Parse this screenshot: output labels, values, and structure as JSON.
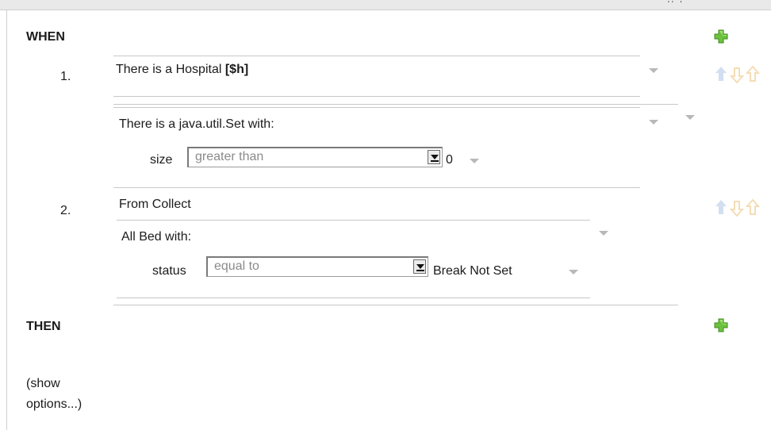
{
  "when": {
    "label": "WHEN"
  },
  "then": {
    "label": "THEN"
  },
  "conditions": [
    {
      "number": "1.",
      "pattern": {
        "text": "There is a Hospital ",
        "binding": "[$h]"
      },
      "from_pattern": {
        "text": "There is a java.util.Set with:",
        "field": "size",
        "operator": "greater than",
        "value": "0"
      }
    },
    {
      "number": "2.",
      "source": "From Collect",
      "collect_pattern": {
        "text": "All Bed with:",
        "field": "status",
        "operator": "equal to",
        "value": "Break Not Set"
      }
    }
  ],
  "show_options": "(show\noptions...)",
  "icons": {
    "add": "plus-icon",
    "move_up": "arrow-up-icon",
    "move_down": "arrow-down-icon",
    "dropdown": "chevron-down-icon",
    "plus_color": "#5fb233"
  }
}
